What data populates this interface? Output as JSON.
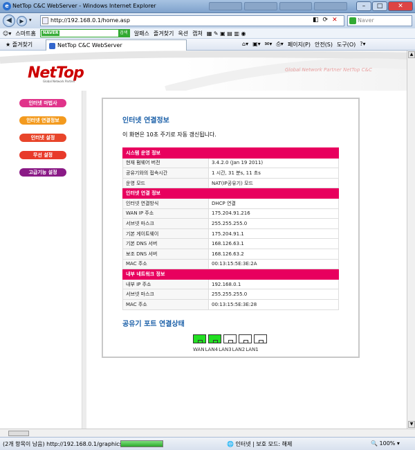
{
  "window": {
    "title": "NetTop C&C WebServer - Windows Internet Explorer",
    "app_icon": "e"
  },
  "browser": {
    "url": "http://192.168.0.1/home.asp",
    "search_placeholder": "Naver",
    "toolbar_items": [
      "스마트홈",
      "알패스",
      "즐겨찾기",
      "옥션",
      "캡쳐"
    ],
    "naver_label": "NAVER",
    "naver_go": "검색",
    "favorites": "즐겨찾기",
    "tab_title": "NetTop C&C WebServer",
    "cmd": {
      "page": "페이지(P)",
      "safety": "안전(S)",
      "tools": "도구(O)"
    }
  },
  "status": {
    "text": "(2개 항목이 남음) http://192.168.0.1/graphics/10",
    "progress": 1.0,
    "zone": "인터넷 | 보호 모드: 해제",
    "zoom": "100%"
  },
  "header": {
    "logo": "NetTop",
    "logo_sub": "Global Network Partner",
    "slogan": "Global Network Partner NetTop C&C"
  },
  "menu": [
    {
      "label": "인터넷 마법사",
      "color": "#e0338a"
    },
    {
      "label": "인터넷 연결정보",
      "color": "#f39a1e"
    },
    {
      "label": "인터넷 설정",
      "color": "#e8452a"
    },
    {
      "label": "무선 설정",
      "color": "#e83a2a"
    },
    {
      "label": "고급기능 설정",
      "color": "#8a1a86"
    }
  ],
  "content": {
    "title": "인터넷 연결정보",
    "refresh_note": "이 화면은 10초 주기로 자동 갱신됩니다.",
    "system": {
      "header": "시스템 운영 정보",
      "rows": [
        {
          "label": "현재 펌웨어 버전",
          "value": "3.4.2.0 (Jan 19 2011)"
        },
        {
          "label": "공유기와의 접속시간",
          "value": "1 시간, 31 분s, 11 초s"
        },
        {
          "label": "운영 모드",
          "value": "NAT(IP공유기) 모드"
        }
      ]
    },
    "internet": {
      "header": "인터넷 연결 정보",
      "rows": [
        {
          "label": "인터넷 연결방식",
          "value": "DHCP 연결"
        },
        {
          "label": "WAN IP 주소",
          "value": "175.204.91.216"
        },
        {
          "label": "서브넷 마스크",
          "value": "255.255.255.0"
        },
        {
          "label": "기본 게이트웨이",
          "value": "175.204.91.1"
        },
        {
          "label": "기본 DNS 서버",
          "value": "168.126.63.1"
        },
        {
          "label": "보조 DNS 서버",
          "value": "168.126.63.2"
        },
        {
          "label": "MAC 주소",
          "value": "00:13:15:5E:3E:2A"
        }
      ]
    },
    "internal": {
      "header": "내부 네트워크 정보",
      "rows": [
        {
          "label": "내부 IP 주소",
          "value": "192.168.0.1"
        },
        {
          "label": "서브넷 마스크",
          "value": "255.255.255.0"
        },
        {
          "label": "MAC 주소",
          "value": "00:13:15:5E:3E:28"
        }
      ]
    },
    "ports_title": "공유기 포트 연결상태",
    "ports": [
      {
        "label": "WAN",
        "connected": true
      },
      {
        "label": "LAN4",
        "connected": true
      },
      {
        "label": "LAN3",
        "connected": false
      },
      {
        "label": "LAN2",
        "connected": false
      },
      {
        "label": "LAN1",
        "connected": false
      }
    ]
  }
}
